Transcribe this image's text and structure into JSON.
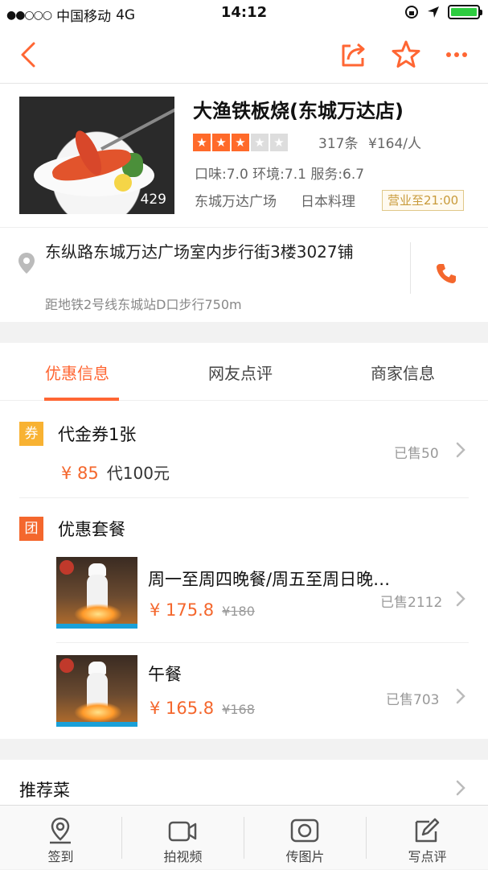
{
  "status_bar": {
    "carrier": "中国移动",
    "network": "4G",
    "time": "14:12"
  },
  "nav": {
    "back_icon": "back-arrow-icon",
    "share_icon": "share-icon",
    "favorite_icon": "star-outline-icon",
    "more_icon": "more-dots-icon",
    "accent": "#ff6633"
  },
  "shop": {
    "name": "大渔铁板烧(东城万达店)",
    "photo_count": "429",
    "rating_stars": 3,
    "reviews": "317条",
    "avg_price": "¥164/人",
    "scores": "口味:7.0 环境:7.1 服务:6.7",
    "area": "东城万达广场",
    "cuisine": "日本料理",
    "hours": "营业至21:00"
  },
  "address": {
    "text": "东纵路东城万达广场室内步行街3楼3027铺",
    "subway": "距地铁2号线东城站D口步行750m"
  },
  "tabs": [
    {
      "label": "优惠信息",
      "active": true
    },
    {
      "label": "网友点评",
      "active": false
    },
    {
      "label": "商家信息",
      "active": false
    }
  ],
  "voucher": {
    "tag": "券",
    "title": "代金券1张",
    "price": "¥ 85",
    "desc": "代100元",
    "sold": "已售50"
  },
  "group": {
    "tag": "团",
    "title": "优惠套餐",
    "packages": [
      {
        "title": "周一至周四晚餐/周五至周日晚…",
        "price": "¥ 175.8",
        "old_price": "¥180",
        "sold": "已售2112"
      },
      {
        "title": "午餐",
        "price": "¥ 165.8",
        "old_price": "¥168",
        "sold": "已售703"
      }
    ]
  },
  "recommend": {
    "title": "推荐菜"
  },
  "bottom_bar": [
    {
      "label": "签到",
      "icon": "location-pin-icon"
    },
    {
      "label": "拍视频",
      "icon": "video-camera-icon"
    },
    {
      "label": "传图片",
      "icon": "photo-icon"
    },
    {
      "label": "写点评",
      "icon": "edit-review-icon"
    }
  ]
}
